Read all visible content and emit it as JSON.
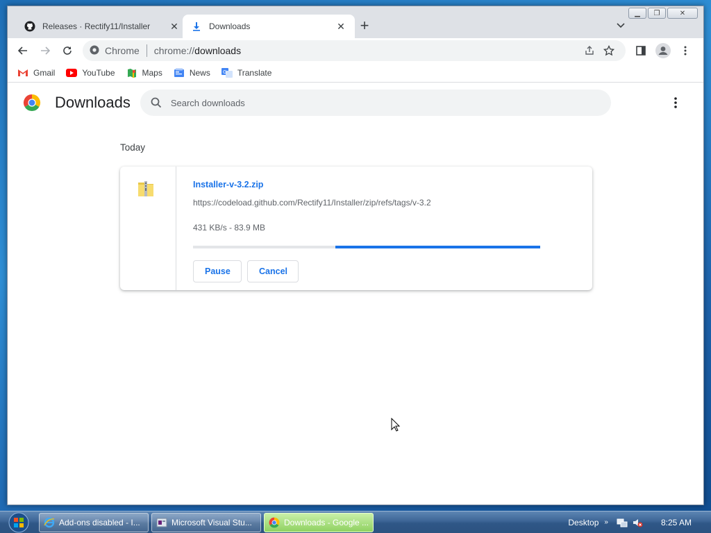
{
  "window": {
    "controls": [
      "minimize",
      "restore",
      "close"
    ]
  },
  "tabs": [
    {
      "title": "Releases · Rectify11/Installer",
      "icon": "github-icon",
      "active": false
    },
    {
      "title": "Downloads",
      "icon": "download-icon",
      "active": true
    }
  ],
  "toolbar": {
    "site_chip": "Chrome",
    "url_scheme": "chrome://",
    "url_path": "downloads"
  },
  "bookmarks": [
    {
      "label": "Gmail",
      "icon": "gmail-icon"
    },
    {
      "label": "YouTube",
      "icon": "youtube-icon"
    },
    {
      "label": "Maps",
      "icon": "maps-icon"
    },
    {
      "label": "News",
      "icon": "news-icon"
    },
    {
      "label": "Translate",
      "icon": "translate-icon"
    }
  ],
  "page": {
    "title": "Downloads",
    "search_placeholder": "Search downloads",
    "date_heading": "Today"
  },
  "download": {
    "file_name": "Installer-v-3.2.zip",
    "url": "https://codeload.github.com/Rectify11/Installer/zip/refs/tags/v-3.2",
    "progress_text": "431 KB/s - 83.9 MB",
    "progress_fraction": 0.59,
    "pause_label": "Pause",
    "cancel_label": "Cancel"
  },
  "taskbar": {
    "items": [
      {
        "label": "Add-ons disabled - I...",
        "icon": "ie-icon",
        "active": false
      },
      {
        "label": "Microsoft Visual Stu...",
        "icon": "installer-icon",
        "active": false
      },
      {
        "label": "Downloads - Google ...",
        "icon": "chrome-icon",
        "active": true
      }
    ],
    "desktop_label": "Desktop",
    "chevron": "»",
    "clock": "8:25 AM"
  },
  "colors": {
    "accent": "#1a73e8",
    "taskbar": "#2f5787"
  }
}
